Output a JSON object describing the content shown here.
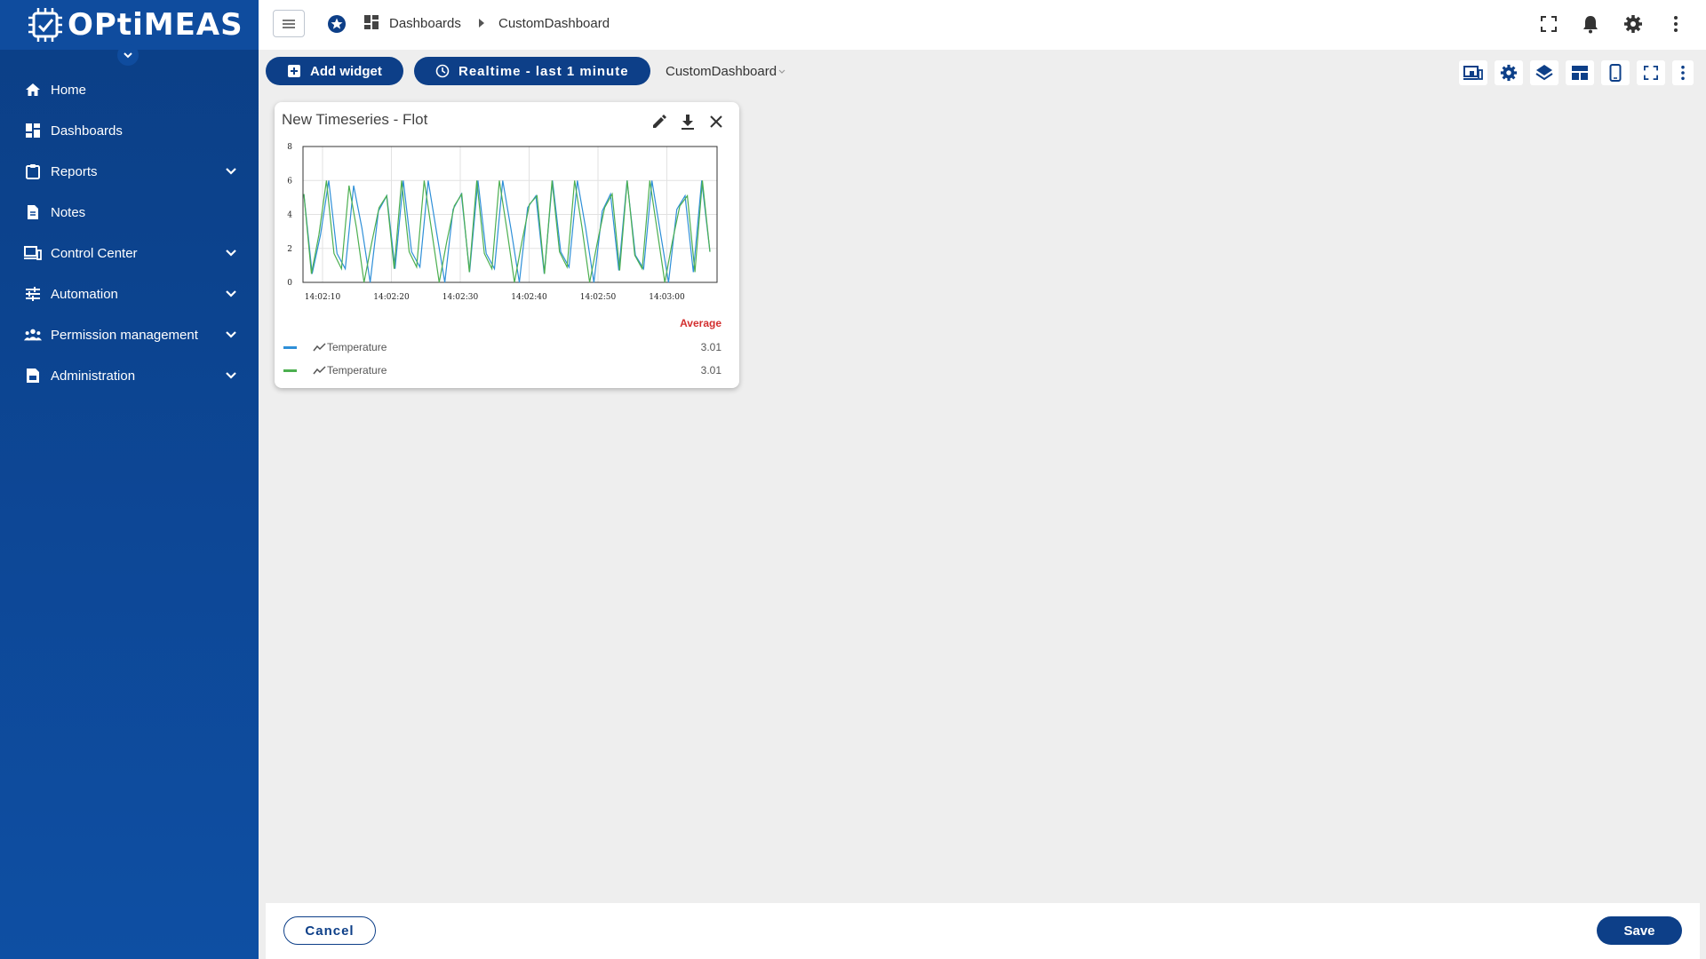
{
  "brand": {
    "logo_text": "OPtiMEAS"
  },
  "sidebar": {
    "items": [
      {
        "label": "Home",
        "icon": "home-icon",
        "expandable": false
      },
      {
        "label": "Dashboards",
        "icon": "dashboard-icon",
        "expandable": false
      },
      {
        "label": "Reports",
        "icon": "clipboard-icon",
        "expandable": true
      },
      {
        "label": "Notes",
        "icon": "note-icon",
        "expandable": false
      },
      {
        "label": "Control Center",
        "icon": "devices-icon",
        "expandable": true
      },
      {
        "label": "Automation",
        "icon": "sliders-icon",
        "expandable": true
      },
      {
        "label": "Permission management",
        "icon": "people-icon",
        "expandable": true
      },
      {
        "label": "Administration",
        "icon": "admin-doc-icon",
        "expandable": true
      }
    ]
  },
  "header": {
    "breadcrumb": [
      "Dashboards",
      "CustomDashboard"
    ]
  },
  "toolbar": {
    "add_widget_label": "Add widget",
    "realtime_label": "Realtime - last 1 minute",
    "dashboard_select": "CustomDashboard"
  },
  "widget": {
    "title": "New Timeseries - Flot",
    "legend_header": "Average",
    "legend": [
      {
        "name": "Temperature",
        "value": "3.01",
        "color": "#2e8fd8"
      },
      {
        "name": "Temperature",
        "value": "3.01",
        "color": "#4caf50"
      }
    ]
  },
  "chart_data": {
    "type": "line",
    "x_tick_labels": [
      "14:02:10",
      "14:02:20",
      "14:02:30",
      "14:02:40",
      "14:02:50",
      "14:03:00"
    ],
    "y_ticks": [
      0,
      2,
      4,
      6,
      8
    ],
    "ylim": [
      0,
      8
    ],
    "grid": true,
    "series": [
      {
        "name": "Temperature",
        "color": "#2e8fd8",
        "values": [
          5.2,
          0.5,
          2.8,
          6,
          1.7,
          0.8,
          5.7,
          3.2,
          0,
          4.2,
          5.1,
          0.8,
          6,
          1.8,
          0.9,
          6,
          3,
          0,
          4.3,
          5.2,
          0.6,
          6,
          1.7,
          0.8,
          6,
          3.1,
          0,
          4.4,
          5.1,
          0.5,
          6,
          1.8,
          0.9,
          6,
          3.2,
          0,
          4.2,
          5.2,
          0.7,
          6,
          1.6,
          0.8,
          6,
          3,
          0,
          4.3,
          5.1,
          0.6,
          6,
          1.8
        ]
      },
      {
        "name": "Temperature",
        "color": "#4caf50",
        "values": [
          5.2,
          0.5,
          2.8,
          6,
          1.7,
          0.8,
          5.7,
          3.2,
          0,
          2.3,
          4.4,
          5.1,
          0.8,
          6,
          1.8,
          0.9,
          6,
          3,
          0,
          2.4,
          4.5,
          5.2,
          0.6,
          6,
          1.7,
          0.8,
          6,
          3.1,
          0,
          2.4,
          4.6,
          5.1,
          0.5,
          6,
          1.8,
          0.9,
          6,
          3.2,
          0,
          2.3,
          4.4,
          5.2,
          0.7,
          6,
          1.6,
          0.8,
          6,
          3.0,
          0,
          2.4,
          4.5,
          5.1,
          0.6,
          6,
          1.8
        ]
      }
    ]
  },
  "footer": {
    "cancel_label": "Cancel",
    "save_label": "Save"
  },
  "colors": {
    "primary": "#0d3f88",
    "sidebar": "#0d4796",
    "accent_red": "#d32f2f"
  }
}
